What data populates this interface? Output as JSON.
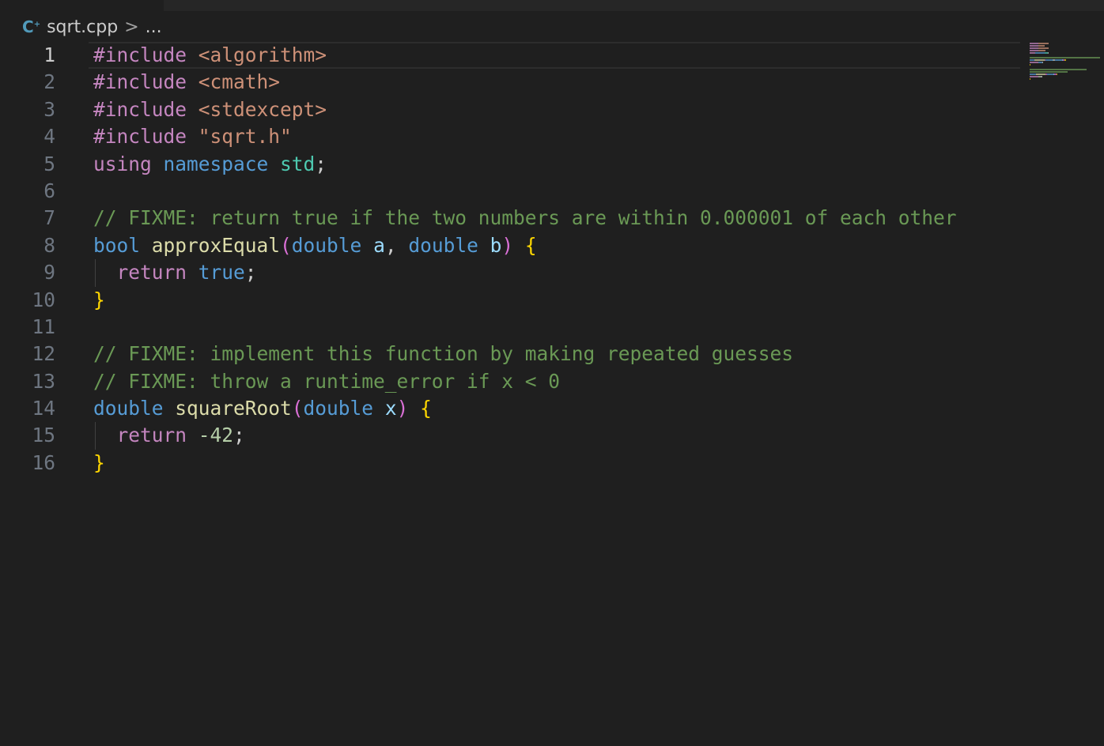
{
  "breadcrumb": {
    "icon": "cpp-file-icon",
    "icon_text": "C",
    "icon_sup": "+",
    "file": "sqrt.cpp",
    "separator": ">",
    "more": "..."
  },
  "editor": {
    "active_line": 1,
    "line_numbers": [
      "1",
      "2",
      "3",
      "4",
      "5",
      "6",
      "7",
      "8",
      "9",
      "10",
      "11",
      "12",
      "13",
      "14",
      "15",
      "16"
    ],
    "lines": [
      [
        {
          "t": "#include ",
          "c": "kw"
        },
        {
          "t": "<algorithm>",
          "c": "str"
        }
      ],
      [
        {
          "t": "#include ",
          "c": "kw"
        },
        {
          "t": "<cmath>",
          "c": "str"
        }
      ],
      [
        {
          "t": "#include ",
          "c": "kw"
        },
        {
          "t": "<stdexcept>",
          "c": "str"
        }
      ],
      [
        {
          "t": "#include ",
          "c": "kw"
        },
        {
          "t": "\"sqrt.h\"",
          "c": "str"
        }
      ],
      [
        {
          "t": "using ",
          "c": "kw"
        },
        {
          "t": "namespace ",
          "c": "type"
        },
        {
          "t": "std",
          "c": "ns"
        },
        {
          "t": ";",
          "c": "punc"
        }
      ],
      [],
      [
        {
          "t": "// FIXME: return true if the two numbers are within 0.000001 of each other",
          "c": "cmt"
        }
      ],
      [
        {
          "t": "bool ",
          "c": "type"
        },
        {
          "t": "approxEqual",
          "c": "fn"
        },
        {
          "t": "(",
          "c": "brk2"
        },
        {
          "t": "double ",
          "c": "type"
        },
        {
          "t": "a",
          "c": "var"
        },
        {
          "t": ", ",
          "c": "punc"
        },
        {
          "t": "double ",
          "c": "type"
        },
        {
          "t": "b",
          "c": "var"
        },
        {
          "t": ") ",
          "c": "brk2"
        },
        {
          "t": "{",
          "c": "brk"
        }
      ],
      [
        {
          "t": "  return ",
          "c": "kw"
        },
        {
          "t": "true",
          "c": "type"
        },
        {
          "t": ";",
          "c": "punc"
        }
      ],
      [
        {
          "t": "}",
          "c": "brk"
        }
      ],
      [],
      [
        {
          "t": "// FIXME: implement this function by making repeated guesses",
          "c": "cmt"
        }
      ],
      [
        {
          "t": "// FIXME: throw a runtime_error if x < 0",
          "c": "cmt"
        }
      ],
      [
        {
          "t": "double ",
          "c": "type"
        },
        {
          "t": "squareRoot",
          "c": "fn"
        },
        {
          "t": "(",
          "c": "brk2"
        },
        {
          "t": "double ",
          "c": "type"
        },
        {
          "t": "x",
          "c": "var"
        },
        {
          "t": ") ",
          "c": "brk2"
        },
        {
          "t": "{",
          "c": "brk"
        }
      ],
      [
        {
          "t": "  return ",
          "c": "kw"
        },
        {
          "t": "-42",
          "c": "num"
        },
        {
          "t": ";",
          "c": "punc"
        }
      ],
      [
        {
          "t": "}",
          "c": "brk"
        }
      ]
    ],
    "indent_guides_on_lines": [
      9,
      15
    ]
  },
  "colors": {
    "background": "#1f1f1f",
    "keyword": "#c586c0",
    "type": "#569cd6",
    "string": "#ce9178",
    "namespace": "#4ec9b0",
    "function": "#dcdcaa",
    "variable": "#9cdcfe",
    "number": "#b5cea8",
    "comment": "#6a9955",
    "bracket": "#ffd700"
  }
}
